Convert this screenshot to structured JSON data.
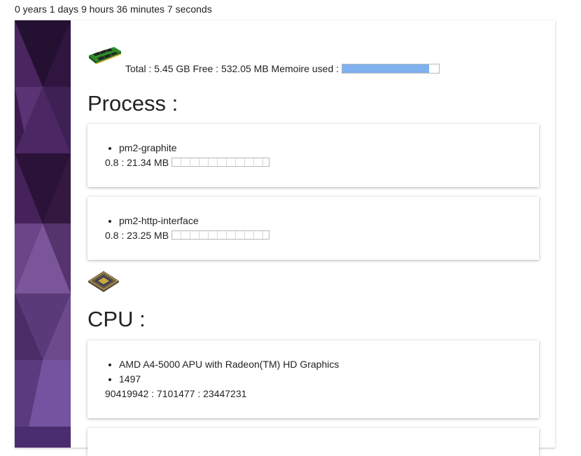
{
  "uptime": "0 years 1 days 9 hours 36 minutes 7 seconds",
  "memory": {
    "icon": "ram-icon",
    "text": "Total : 5.45 GB Free : 532.05 MB Memoire used :",
    "used_fraction": 0.9,
    "bar_color": "#7fb0f0"
  },
  "process": {
    "heading": "Process :",
    "items": [
      {
        "name": "pm2-graphite",
        "stats": "0.8 : 21.34 MB",
        "usage_fraction": 0.0
      },
      {
        "name": "pm2-http-interface",
        "stats": "0.8 : 23.25 MB",
        "usage_fraction": 0.0
      }
    ]
  },
  "cpu": {
    "icon": "cpu-icon",
    "heading": "CPU :",
    "model": "AMD A4-5000 APU with Radeon(TM) HD Graphics",
    "speed": "1497",
    "times": "90419942 : 7101477 : 23447231"
  },
  "colors": {
    "sidebar_base": "#3b1a4f",
    "sidebar_light": "#7a4f9a"
  }
}
